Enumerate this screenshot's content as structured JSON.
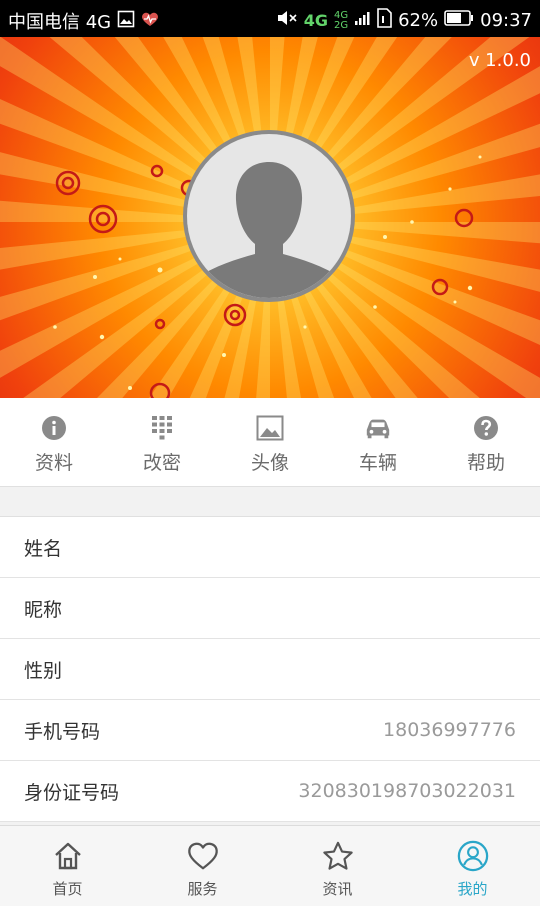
{
  "status_bar": {
    "carrier": "中国电信 4G",
    "net_small_top": "4G",
    "net_small_bottom": "2G",
    "net_main": "4G",
    "battery": "62%",
    "time": "09:37"
  },
  "hero": {
    "version": "v 1.0.0"
  },
  "actions": [
    {
      "label": "资料",
      "icon": "info-icon"
    },
    {
      "label": "改密",
      "icon": "keypad-icon"
    },
    {
      "label": "头像",
      "icon": "image-icon"
    },
    {
      "label": "车辆",
      "icon": "car-icon"
    },
    {
      "label": "帮助",
      "icon": "help-icon"
    }
  ],
  "profile_rows": [
    {
      "label": "姓名",
      "value": ""
    },
    {
      "label": "昵称",
      "value": ""
    },
    {
      "label": "性别",
      "value": ""
    },
    {
      "label": "手机号码",
      "value": "18036997776"
    },
    {
      "label": "身份证号码",
      "value": "320830198703022031"
    }
  ],
  "bottom_nav": [
    {
      "label": "首页",
      "icon": "home-icon",
      "active": false
    },
    {
      "label": "服务",
      "icon": "heart-icon",
      "active": false
    },
    {
      "label": "资讯",
      "icon": "star-icon",
      "active": false
    },
    {
      "label": "我的",
      "icon": "profile-icon",
      "active": true
    }
  ],
  "colors": {
    "active_tab": "#2aa6c8",
    "hero_outer": "#d41a12",
    "hero_center": "#ffc02a"
  }
}
